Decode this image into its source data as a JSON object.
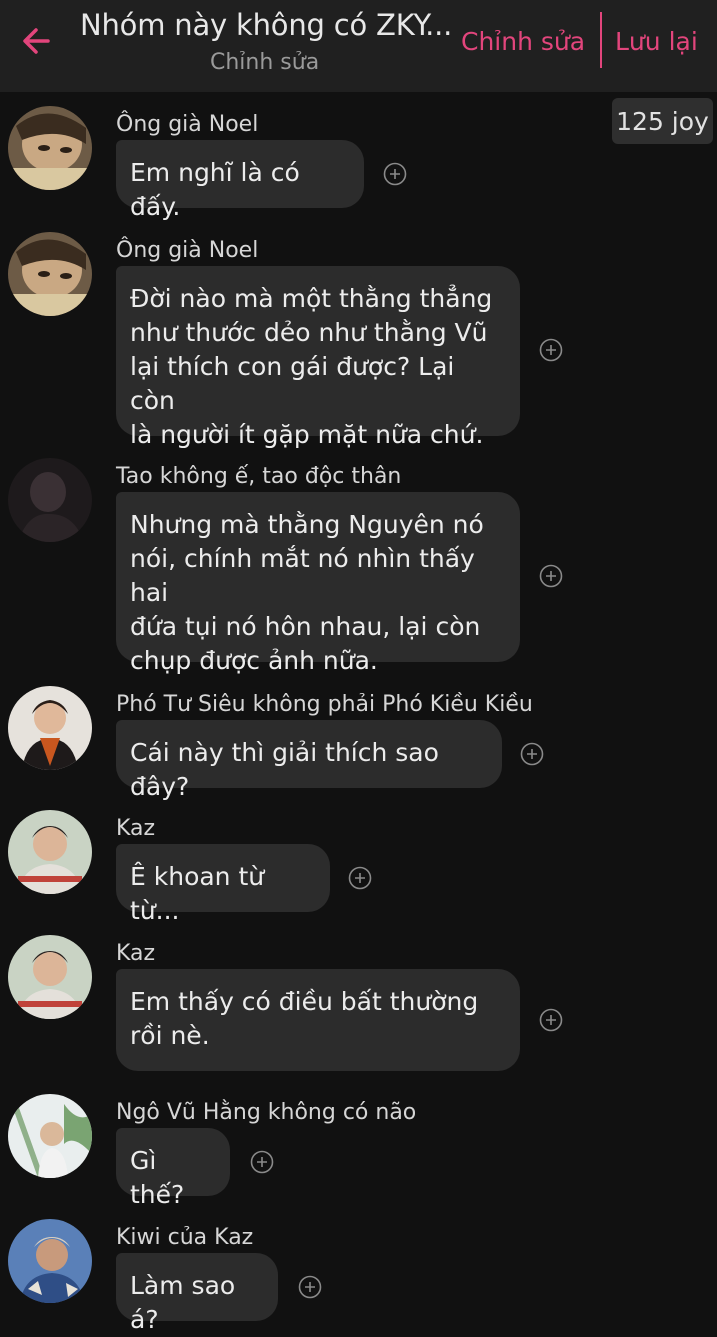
{
  "header": {
    "title": "Nhóm này không có ZKY...",
    "subtitle": "Chỉnh sửa",
    "edit_label": "Chỉnh sửa",
    "save_label": "Lưu lại",
    "accent_color": "#e2457c"
  },
  "joy_badge": "125 joy",
  "messages": [
    {
      "sender": "Ông già Noel",
      "text": "Em nghĩ là có đấy."
    },
    {
      "sender": "Ông già Noel",
      "text": "Đời nào mà một thằng thẳng\nnhư thước dẻo như thằng Vũ\nlại thích con gái được? Lại còn\nlà người ít gặp mặt nữa chứ."
    },
    {
      "sender": "Tao không ế, tao độc thân",
      "text": "Nhưng mà thằng Nguyên nó\nnói, chính mắt nó nhìn thấy hai\nđứa tụi nó hôn nhau, lại còn\nchụp được ảnh nữa."
    },
    {
      "sender": "Phó Tư Siêu không phải Phó Kiều Kiều",
      "text": "Cái này thì giải thích sao đây?"
    },
    {
      "sender": "Kaz",
      "text": "Ê khoan từ từ..."
    },
    {
      "sender": "Kaz",
      "text": "Em thấy có điều bất thường\nrồi nè."
    },
    {
      "sender": "Ngô Vũ Hằng không có não",
      "text": "Gì thế?"
    },
    {
      "sender": "Kiwi của Kaz",
      "text": "Làm sao á?"
    }
  ],
  "icons": {
    "back": "back-arrow-icon",
    "reaction": "add-reaction-icon"
  }
}
